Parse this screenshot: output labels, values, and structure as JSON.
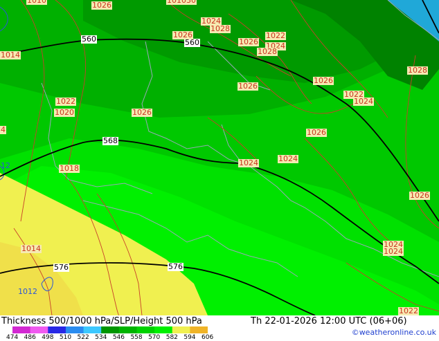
{
  "title": "Thickness 500/1000 hPa/SLP/Height 500 hPa",
  "valid_time": "Th 22-01-2026 12:00 UTC (06+06)",
  "credit": "©weatheronline.co.uk",
  "legend": {
    "ticks": [
      "474",
      "486",
      "498",
      "510",
      "522",
      "534",
      "546",
      "558",
      "570",
      "582",
      "594",
      "606"
    ],
    "colors": [
      "#d228d2",
      "#f05af0",
      "#2828e6",
      "#2a8cf0",
      "#3cc8ff",
      "#009600",
      "#00b400",
      "#00d200",
      "#00f000",
      "#f0f050",
      "#f0b428"
    ]
  },
  "height_labels": [
    "560",
    "560",
    "568",
    "576",
    "576"
  ],
  "slp_labels": [
    "1010",
    "1026",
    "101030",
    "1024",
    "1028",
    "1026",
    "1026",
    "1022",
    "1024",
    "1028",
    "1014",
    "1028",
    "1026",
    "1022",
    "1024",
    "1026",
    "1022",
    "1020",
    "1026",
    "1026",
    "1024",
    "1024",
    "1018",
    "1026",
    "1014",
    "1024",
    "1024",
    "1022",
    "12",
    "4",
    "1012"
  ]
}
